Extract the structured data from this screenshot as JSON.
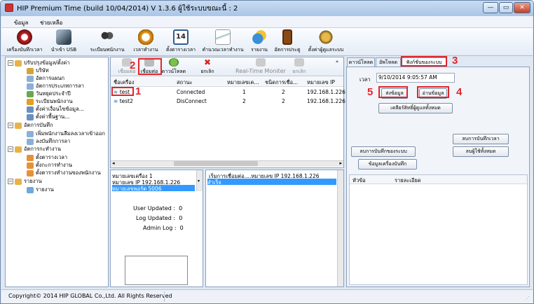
{
  "app": {
    "title": "HIP Premium Time (build 10/04/2014) V 1.3.6  ผู้ใช้ระบบขณะนี้ : 2"
  },
  "window_buttons": {
    "minimize": "—",
    "maximize": "▭",
    "close": "✕"
  },
  "menu": [
    "ข้อมูล",
    "ช่วยเหลือ"
  ],
  "toolbar": [
    {
      "label": "เครื่องบันทึกเวลา",
      "icon": "clock-device-icon"
    },
    {
      "label": "นำเข้า USB",
      "icon": "usb-icon"
    },
    {
      "label": "ระเบียนพนักงาน",
      "icon": "employees-icon"
    },
    {
      "label": "เวลาทำงาน",
      "icon": "alarm-clock-icon"
    },
    {
      "label": "ตั้งตารางเวลา",
      "icon": "calendar-icon",
      "calendar_day": "14"
    },
    {
      "label": "คำนวณเวลาทำงาน",
      "icon": "calculate-icon"
    },
    {
      "label": "รายงาน",
      "icon": "report-icon"
    },
    {
      "label": "อัตการประตู",
      "icon": "door-icon"
    },
    {
      "label": "ตั้งค่าผู้ดูแลระบบ",
      "icon": "admin-settings-icon"
    }
  ],
  "tree": {
    "groups": [
      {
        "label": "ปรับปรุงข้อมูล/ตั้งค่า",
        "children": [
          "บริษัท",
          "อัตการแผนก",
          "อัตการประเภทการลา",
          "วันหยุดประจำปี",
          "ระเบียนพนักงาน",
          "ตั้งค่าเงื่อนไขข้อมูล...",
          "ตั้งค่าพื้นฐาน..."
        ]
      },
      {
        "label": "อัตการบันทึก",
        "children": [
          "เพิ่มพนักงานลืมลงเวลาเข้าออก",
          "ลงบันทึกการลา"
        ]
      },
      {
        "label": "อัตการกะทำงาน",
        "children": [
          "ตั้งตารางเวลา",
          "ตั้งกะการทำงาน",
          "ตั้งตารางทำงานของพนักงาน"
        ]
      },
      {
        "label": "รายงาน",
        "children": [
          "รายงาน"
        ]
      }
    ]
  },
  "device_toolbar": {
    "connect": "เชื่อมต่อ",
    "disconnect": "เชื่อมต่อ",
    "download": "ดาวน์โหลด",
    "cancel": "ยกเลิก",
    "realtime": "Real-Time Moniter",
    "cancel2": "ยกเลิก",
    "more": "»"
  },
  "device_table": {
    "columns": [
      "ชื่อเครื่อง",
      "สถานะ",
      "หมายเลขเค...",
      "ชนิดการเชื่อ...",
      "หมายเลข IP"
    ],
    "rows": [
      [
        "test",
        "Connected",
        "1",
        "2",
        "192.168.1.226"
      ],
      [
        "test2",
        "DisConnect",
        "2",
        "2",
        "192.168.1.226"
      ]
    ]
  },
  "device_info": {
    "lines": [
      "หมายเลขเครื่อง  1",
      "หมายเลข IP   192.168.1.226",
      "หมายเลขพอร์ต  5006"
    ],
    "user_updated_label": "User Updated :",
    "user_updated_value": "0",
    "log_updated_label": "Log Updated :",
    "log_updated_value": "0",
    "admin_log_label": "Admin Log :",
    "admin_log_value": "0"
  },
  "log_box": {
    "lines": [
      "เริ่มการเชื่อมต่อ....หมายเลข IP   192.168.1.226",
      "สำเร็จ"
    ]
  },
  "right_tabs": [
    "ดาวน์โหลด",
    "อัพโหลด",
    "ฟังก์ชั่นของระบบ"
  ],
  "function_tab": {
    "time_label": "เวลา",
    "time_value": "9/10/2014 9:05:57 AM",
    "send_time": "ส่งข้อมูล",
    "read_time": "อ่านข้อมูล",
    "clear_admin": "เคลียร์สิทธิ์ผู้ดูแลทั้งหมด",
    "delete_time_log": "ลบการบันทึกเวลา",
    "delete_sys_log": "ลบการบันทึกของระบบ",
    "delete_all_users": "ลบผู้ใช้ทั้งหมด",
    "device_info": "ข้อมูลเครื่องบันทึก",
    "table_cols": [
      "หัวข้อ",
      "รายละเอียด"
    ]
  },
  "annotations": [
    "1",
    "2",
    "3",
    "4",
    "5"
  ],
  "status": {
    "copyright": "Copyright© 2014 HIP GLOBAL Co.,Ltd. All Rights Reserved"
  },
  "colors": {
    "accent": "#e0262a",
    "selected": "#3399ff",
    "chrome": "#dfe8f3"
  }
}
